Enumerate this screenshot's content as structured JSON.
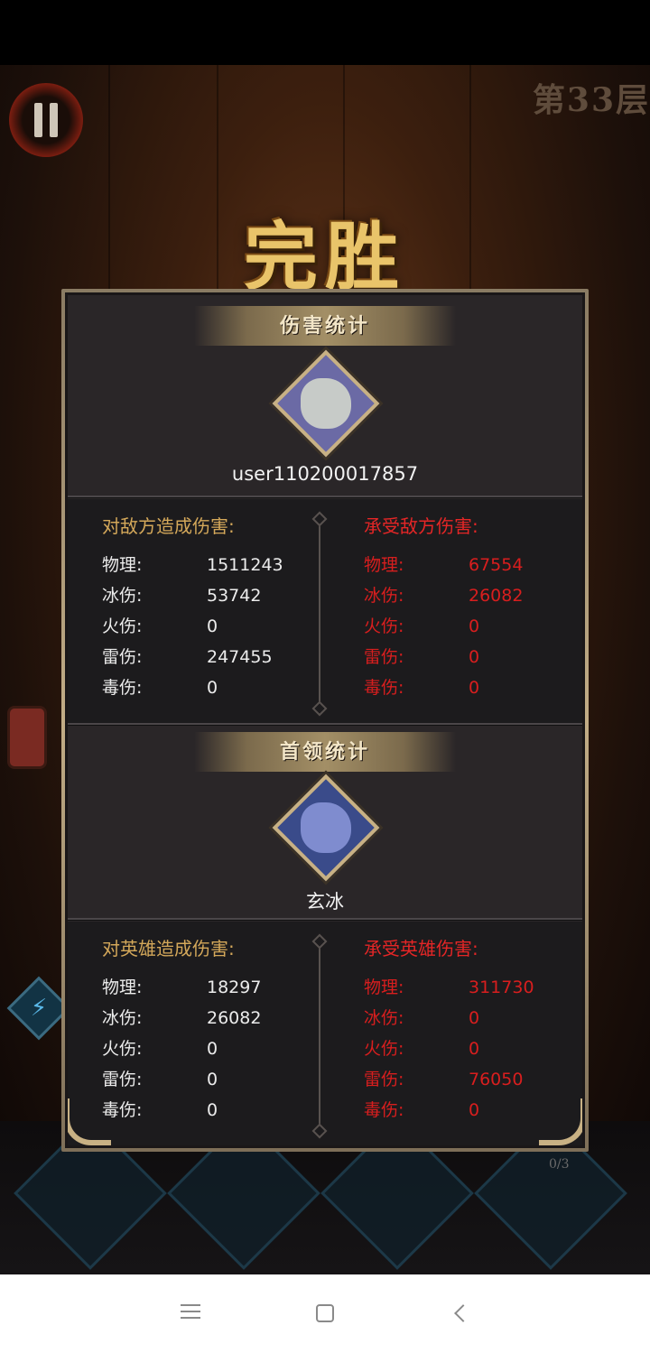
{
  "hud": {
    "floor_label": "第33层",
    "counter": "0/3"
  },
  "victory_title": "完胜",
  "damage_stats": {
    "title": "伤害统计",
    "player_name": "user110200017857",
    "dealt": {
      "heading": "对敌方造成伤害:",
      "rows": [
        {
          "label": "物理:",
          "value": "1511243"
        },
        {
          "label": "冰伤:",
          "value": "53742"
        },
        {
          "label": "火伤:",
          "value": "0"
        },
        {
          "label": "雷伤:",
          "value": "247455"
        },
        {
          "label": "毒伤:",
          "value": "0"
        }
      ]
    },
    "taken": {
      "heading": "承受敌方伤害:",
      "rows": [
        {
          "label": "物理:",
          "value": "67554"
        },
        {
          "label": "冰伤:",
          "value": "26082"
        },
        {
          "label": "火伤:",
          "value": "0"
        },
        {
          "label": "雷伤:",
          "value": "0"
        },
        {
          "label": "毒伤:",
          "value": "0"
        }
      ]
    }
  },
  "boss_stats": {
    "title": "首领统计",
    "boss_name": "玄冰",
    "dealt": {
      "heading": "对英雄造成伤害:",
      "rows": [
        {
          "label": "物理:",
          "value": "18297"
        },
        {
          "label": "冰伤:",
          "value": "26082"
        },
        {
          "label": "火伤:",
          "value": "0"
        },
        {
          "label": "雷伤:",
          "value": "0"
        },
        {
          "label": "毒伤:",
          "value": "0"
        }
      ]
    },
    "taken": {
      "heading": "承受英雄伤害:",
      "rows": [
        {
          "label": "物理:",
          "value": "311730"
        },
        {
          "label": "冰伤:",
          "value": "0"
        },
        {
          "label": "火伤:",
          "value": "0"
        },
        {
          "label": "雷伤:",
          "value": "76050"
        },
        {
          "label": "毒伤:",
          "value": "0"
        }
      ]
    }
  },
  "icons": {
    "pause": "pause-icon",
    "lantern": "lantern-icon",
    "lightning": "lightning-icon",
    "menu": "menu-icon",
    "home": "home-icon",
    "back": "back-icon"
  },
  "colors": {
    "gold": "#d4a85a",
    "damage_taken_red": "#d81e1e",
    "panel_bg": "#2a2628"
  }
}
